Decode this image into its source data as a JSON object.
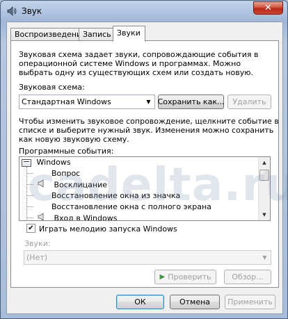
{
  "window": {
    "title": "Звук",
    "close_glyph": "✕"
  },
  "tabs": [
    {
      "label": "Воспроизведение",
      "active": false
    },
    {
      "label": "Запись",
      "active": false
    },
    {
      "label": "Звуки",
      "active": true
    }
  ],
  "sounds": {
    "description": [
      "Звуковая схема задает звуки, сопровождающие события в",
      "операционной системе Windows и программах. Можно",
      "выбрать одну из существующих схем или создать новую."
    ],
    "scheme_label": "Звуковая схема:",
    "scheme_value": "Стандартная Windows",
    "save_as_label": "Сохранить как...",
    "delete_label": "Удалить",
    "instruction": [
      "Чтобы изменить звуковое сопровождение, щелкните  событие в",
      "списке и выберите нужный звук. Изменения можно сохранить",
      "как новую звуковую схему."
    ],
    "events_label": "Программные события:",
    "events": [
      {
        "label": "Windows",
        "level": 0,
        "icon": "windows-group-icon"
      },
      {
        "label": "Вопрос",
        "level": 1,
        "icon": ""
      },
      {
        "label": "Восклицание",
        "level": 1,
        "icon": "speaker-icon"
      },
      {
        "label": "Восстановление окна из значка",
        "level": 1,
        "icon": ""
      },
      {
        "label": "Восстановление окна с полного экрана",
        "level": 1,
        "icon": ""
      },
      {
        "label": "Вход в Windows",
        "level": 1,
        "icon": "speaker-icon"
      }
    ],
    "startup_checkbox_label": "Играть мелодию запуска Windows",
    "startup_checked": true,
    "sounds_label": "Звуки:",
    "sound_value": "(Нет)",
    "test_label": "Проверить",
    "browse_label": "Обзор..."
  },
  "footer": {
    "ok_label": "ОК",
    "cancel_label": "Отмена",
    "apply_label": "Применить"
  },
  "watermark": "cadelta.ru"
}
